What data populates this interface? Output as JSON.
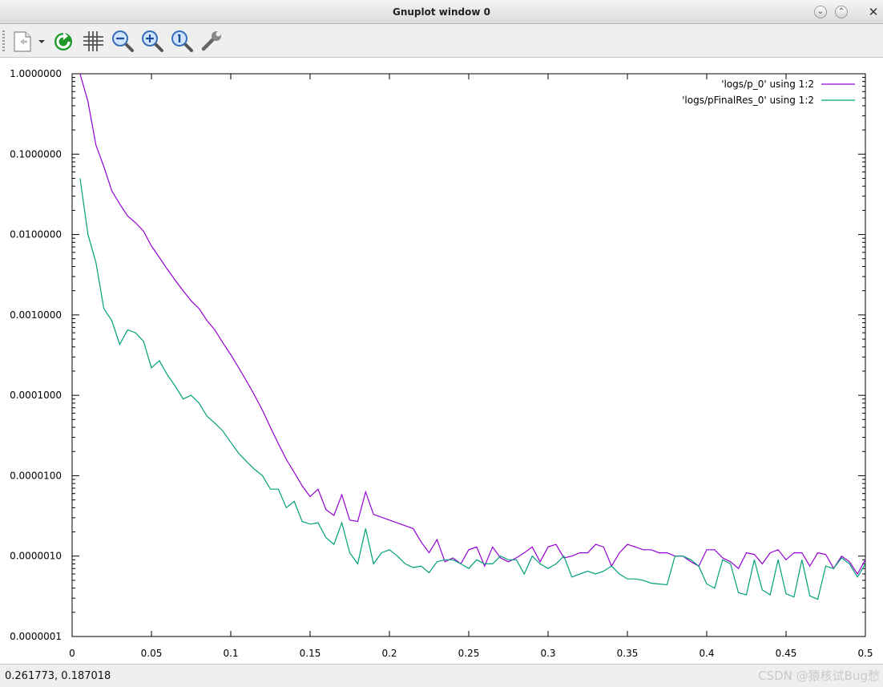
{
  "window": {
    "title": "Gnuplot window 0",
    "close_glyph": "✕",
    "minimize_glyph": "⌄",
    "maximize_glyph": "⌃"
  },
  "toolbar": {
    "icons": [
      "export-icon",
      "replot-icon",
      "grid-icon",
      "zoom-out-icon",
      "zoom-in-icon",
      "zoom-fit-icon",
      "settings-wrench-icon"
    ]
  },
  "status": {
    "coords": "0.261773,  0.187018"
  },
  "watermark": "CSDN @猿核试Bug愁",
  "chart_data": {
    "type": "line",
    "x_ticks": [
      0,
      0.05,
      0.1,
      0.15,
      0.2,
      0.25,
      0.3,
      0.35,
      0.4,
      0.45,
      0.5
    ],
    "x_tick_labels": [
      "0",
      "0.05",
      "0.1",
      "0.15",
      "0.2",
      "0.25",
      "0.3",
      "0.35",
      "0.4",
      "0.45",
      "0.5"
    ],
    "y_ticks": [
      1e-07,
      1e-06,
      1e-05,
      0.0001,
      0.001,
      0.01,
      0.1,
      1
    ],
    "y_tick_labels": [
      "0.0000001",
      "0.0000010",
      "0.0000100",
      "0.0001000",
      "0.0010000",
      "0.0100000",
      "0.1000000",
      "1.0000000"
    ],
    "xlim": [
      0,
      0.5
    ],
    "ylim": [
      1e-07,
      1
    ],
    "y_scale": "log",
    "grid": false,
    "legend_position": "top-right",
    "series": [
      {
        "name": "'logs/p_0' using 1:2",
        "color": "#9400d3",
        "x": [
          0.005,
          0.01,
          0.015,
          0.02,
          0.025,
          0.03,
          0.035,
          0.04,
          0.045,
          0.05,
          0.055,
          0.06,
          0.065,
          0.07,
          0.075,
          0.08,
          0.085,
          0.09,
          0.095,
          0.1,
          0.105,
          0.11,
          0.115,
          0.12,
          0.125,
          0.13,
          0.135,
          0.14,
          0.145,
          0.15,
          0.155,
          0.16,
          0.165,
          0.17,
          0.175,
          0.18,
          0.185,
          0.19,
          0.215,
          0.22,
          0.225,
          0.23,
          0.235,
          0.24,
          0.245,
          0.25,
          0.255,
          0.26,
          0.265,
          0.27,
          0.275,
          0.28,
          0.285,
          0.29,
          0.295,
          0.3,
          0.305,
          0.31,
          0.315,
          0.32,
          0.325,
          0.33,
          0.335,
          0.34,
          0.345,
          0.35,
          0.355,
          0.36,
          0.365,
          0.37,
          0.375,
          0.38,
          0.385,
          0.39,
          0.395,
          0.4,
          0.405,
          0.41,
          0.415,
          0.42,
          0.425,
          0.43,
          0.435,
          0.44,
          0.445,
          0.45,
          0.455,
          0.46,
          0.465,
          0.47,
          0.475,
          0.48,
          0.485,
          0.49,
          0.495,
          0.5
        ],
        "y": [
          1.0,
          0.45,
          0.13,
          0.07,
          0.035,
          0.024,
          0.017,
          0.014,
          0.011,
          0.0072,
          0.0052,
          0.0037,
          0.0027,
          0.002,
          0.0015,
          0.0012,
          0.00085,
          0.00065,
          0.00045,
          0.00032,
          0.00022,
          0.00015,
          0.0001,
          6.5e-05,
          4e-05,
          2.5e-05,
          1.6e-05,
          1.1e-05,
          7.5e-06,
          5.5e-06,
          6.8e-06,
          3.8e-06,
          3.2e-06,
          5.8e-06,
          2.8e-06,
          2.7e-06,
          6.3e-06,
          3.3e-06,
          2.2e-06,
          1.5e-06,
          1.1e-06,
          1.6e-06,
          8.5e-07,
          9.5e-07,
          8e-07,
          1.2e-06,
          1.3e-06,
          7.5e-07,
          1.3e-06,
          9.5e-07,
          8.5e-07,
          9.5e-07,
          1.1e-06,
          1.3e-06,
          8.5e-07,
          1.3e-06,
          1.4e-06,
          9.5e-07,
          1e-06,
          1.1e-06,
          1.1e-06,
          1.4e-06,
          1.3e-06,
          7.5e-07,
          1.1e-06,
          1.4e-06,
          1.3e-06,
          1.2e-06,
          1.2e-06,
          1.1e-06,
          1.1e-06,
          1e-06,
          1e-06,
          8.5e-07,
          7.5e-07,
          1.2e-06,
          1.2e-06,
          9.5e-07,
          8.5e-07,
          7e-07,
          1.1e-06,
          1.05e-06,
          8e-07,
          1.1e-06,
          1.2e-06,
          9e-07,
          1.1e-06,
          1.1e-06,
          7.5e-07,
          1.1e-06,
          1.05e-06,
          7e-07,
          1e-06,
          8.5e-07,
          6e-07,
          9e-07
        ]
      },
      {
        "name": "'logs/pFinalRes_0' using 1:2",
        "color": "#00a07a",
        "x": [
          0.005,
          0.01,
          0.015,
          0.02,
          0.025,
          0.03,
          0.035,
          0.04,
          0.045,
          0.05,
          0.055,
          0.06,
          0.065,
          0.07,
          0.075,
          0.08,
          0.085,
          0.09,
          0.095,
          0.1,
          0.105,
          0.11,
          0.115,
          0.12,
          0.125,
          0.13,
          0.135,
          0.14,
          0.145,
          0.15,
          0.155,
          0.16,
          0.165,
          0.17,
          0.175,
          0.18,
          0.185,
          0.19,
          0.195,
          0.2,
          0.205,
          0.21,
          0.215,
          0.22,
          0.225,
          0.23,
          0.235,
          0.24,
          0.245,
          0.25,
          0.255,
          0.26,
          0.265,
          0.27,
          0.275,
          0.28,
          0.285,
          0.29,
          0.295,
          0.3,
          0.305,
          0.31,
          0.315,
          0.32,
          0.325,
          0.33,
          0.335,
          0.34,
          0.345,
          0.35,
          0.355,
          0.36,
          0.365,
          0.37,
          0.375,
          0.38,
          0.385,
          0.39,
          0.395,
          0.4,
          0.405,
          0.41,
          0.415,
          0.42,
          0.425,
          0.43,
          0.435,
          0.44,
          0.445,
          0.45,
          0.455,
          0.46,
          0.465,
          0.47,
          0.475,
          0.48,
          0.485,
          0.49,
          0.495,
          0.5
        ],
        "y": [
          0.05,
          0.01,
          0.0045,
          0.0012,
          0.00085,
          0.00043,
          0.00065,
          0.0006,
          0.00047,
          0.00022,
          0.00027,
          0.00018,
          0.00013,
          9e-05,
          0.0001,
          8e-05,
          5.5e-05,
          4.5e-05,
          3.6e-05,
          2.6e-05,
          1.9e-05,
          1.5e-05,
          1.2e-05,
          1e-05,
          6.8e-06,
          6.8e-06,
          4e-06,
          4.8e-06,
          2.7e-06,
          2.5e-06,
          2.6e-06,
          1.7e-06,
          1.4e-06,
          2.6e-06,
          1.1e-06,
          8e-07,
          2.2e-06,
          8e-07,
          1.1e-06,
          1.2e-06,
          1e-06,
          8e-07,
          7.2e-07,
          7.5e-07,
          6.2e-07,
          8.5e-07,
          9e-07,
          9e-07,
          8e-07,
          7e-07,
          9e-07,
          8e-07,
          8e-07,
          1e-06,
          9e-07,
          9e-07,
          6e-07,
          1e-06,
          8e-07,
          7e-07,
          8e-07,
          1e-06,
          5.5e-07,
          6e-07,
          6.5e-07,
          6e-07,
          6.5e-07,
          7.5e-07,
          6e-07,
          5.2e-07,
          5.2e-07,
          5e-07,
          4.6e-07,
          4.5e-07,
          4.4e-07,
          1e-06,
          1e-06,
          9e-07,
          7.5e-07,
          4.5e-07,
          4e-07,
          9e-07,
          8e-07,
          3.5e-07,
          3.3e-07,
          9e-07,
          3.8e-07,
          3.3e-07,
          9e-07,
          3.4e-07,
          3.1e-07,
          9e-07,
          3.2e-07,
          2.9e-07,
          7.5e-07,
          7e-07,
          9.5e-07,
          8e-07,
          5.5e-07,
          8e-07
        ]
      }
    ]
  }
}
